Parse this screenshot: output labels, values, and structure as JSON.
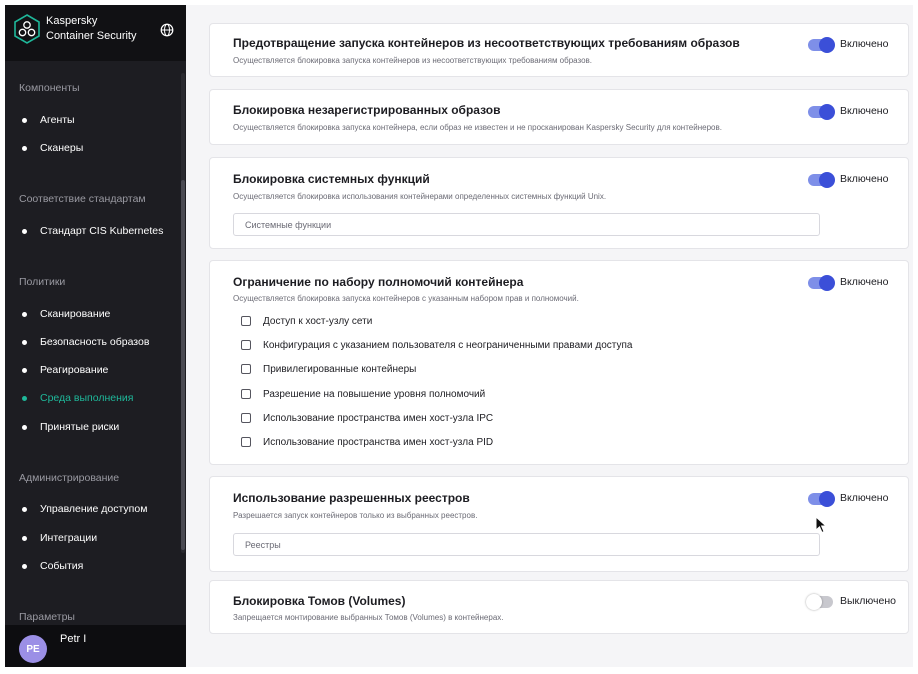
{
  "brand": {
    "line1": "Kaspersky",
    "line2": "Container Security"
  },
  "sidebar": {
    "sections": [
      {
        "title": "Компоненты",
        "items": [
          {
            "label": "Агенты"
          },
          {
            "label": "Сканеры"
          }
        ]
      },
      {
        "title": "Соответствие стандартам",
        "items": [
          {
            "label": "Стандарт CIS Kubernetes"
          }
        ]
      },
      {
        "title": "Политики",
        "items": [
          {
            "label": "Сканирование"
          },
          {
            "label": "Безопасность образов"
          },
          {
            "label": "Реагирование"
          },
          {
            "label": "Среда выполнения",
            "active": true
          },
          {
            "label": "Принятые риски"
          }
        ]
      },
      {
        "title": "Администрирование",
        "items": [
          {
            "label": "Управление доступом"
          },
          {
            "label": "Интеграции"
          },
          {
            "label": "События"
          }
        ]
      },
      {
        "title": "Параметры",
        "items": []
      }
    ],
    "user": {
      "initials": "PE",
      "name": "Petr I"
    }
  },
  "cards": [
    {
      "title": "Предотвращение запуска контейнеров из несоответствующих требованиям образов",
      "desc": "Осуществляется блокировка запуска контейнеров из несоответствующих требованиям образов.",
      "toggle": {
        "on": true,
        "label": "Включено"
      }
    },
    {
      "title": "Блокировка незарегистрированных образов",
      "desc": "Осуществляется блокировка запуска контейнера, если образ не известен и не просканирован Kaspersky Security для контейнеров.",
      "toggle": {
        "on": true,
        "label": "Включено"
      }
    },
    {
      "title": "Блокировка системных функций",
      "desc": "Осуществляется блокировка использования контейнерами определенных системных функций Unix.",
      "toggle": {
        "on": true,
        "label": "Включено"
      },
      "input": {
        "placeholder": "Системные функции",
        "value": ""
      }
    },
    {
      "title": "Ограничение по набору полномочий контейнера",
      "desc": "Осуществляется блокировка запуска контейнеров с указанным набором прав и полномочий.",
      "toggle": {
        "on": true,
        "label": "Включено"
      },
      "checkboxes": [
        {
          "label": "Доступ к хост-узлу сети",
          "checked": false
        },
        {
          "label": "Конфигурация с указанием пользователя с неограниченными правами доступа",
          "checked": false
        },
        {
          "label": "Привилегированные контейнеры",
          "checked": false
        },
        {
          "label": "Разрешение на повышение уровня полномочий",
          "checked": false
        },
        {
          "label": "Использование пространства имен хост-узла IPC",
          "checked": false
        },
        {
          "label": "Использование пространства имен хост-узла PID",
          "checked": false
        }
      ]
    },
    {
      "title": "Использование разрешенных реестров",
      "desc": "Разрешается запуск контейнеров только из выбранных реестров.",
      "toggle": {
        "on": true,
        "label": "Включено"
      },
      "input": {
        "placeholder": "Реестры",
        "value": ""
      }
    },
    {
      "title": "Блокировка Томов (Volumes)",
      "desc": "Запрещается монтирование выбранных Томов (Volumes) в контейнерах.",
      "toggle": {
        "on": false,
        "label": "Выключено"
      }
    }
  ],
  "colors": {
    "sidebar_bg": "#1d1d22",
    "active_nav": "#1fb89a",
    "toggle_on": "#3b4fd8",
    "avatar": "#9b8fe6"
  }
}
